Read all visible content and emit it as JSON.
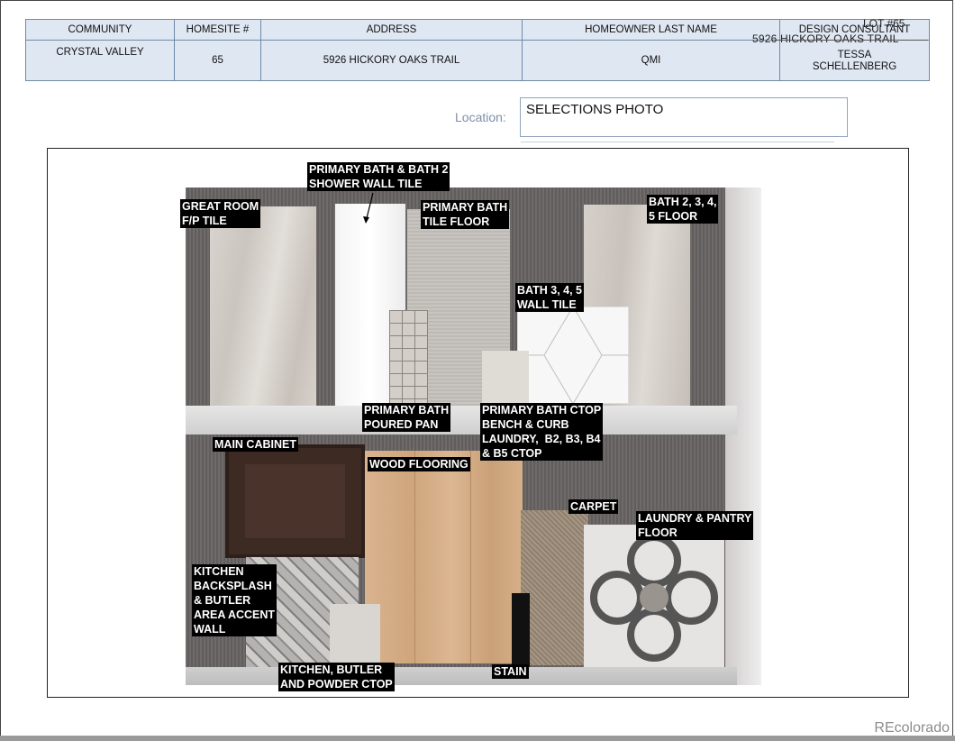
{
  "header": {
    "columns": [
      {
        "key": "community",
        "label": "COMMUNITY",
        "value": "CRYSTAL VALLEY"
      },
      {
        "key": "homesite",
        "label": "HOMESITE #",
        "value": "65"
      },
      {
        "key": "address",
        "label": "ADDRESS",
        "value": "5926 HICKORY OAKS TRAIL"
      },
      {
        "key": "homeowner",
        "label": "HOMEOWNER LAST NAME",
        "value": "QMI"
      },
      {
        "key": "consultant",
        "label": "DESIGN CONSULTANT",
        "value": "TESSA\nSCHELLENBERG"
      }
    ],
    "lot_overlay": "LOT #65",
    "address_overlay": "5926 HICKORY OAKS TRAIL"
  },
  "location": {
    "label": "Location:",
    "value": "SELECTIONS PHOTO"
  },
  "photo_labels": {
    "great_room": "GREAT ROOM\nF/P TILE",
    "shower_wall": "PRIMARY BATH & BATH 2\nSHOWER WALL TILE",
    "primary_floor": "PRIMARY BATH\nTILE FLOOR",
    "bath_floor": "BATH 2, 3, 4,\n5 FLOOR",
    "bath_wall": "BATH 3, 4, 5\nWALL TILE",
    "poured_pan": "PRIMARY BATH\nPOURED PAN",
    "ctop": "PRIMARY BATH CTOP\nBENCH & CURB\nLAUNDRY,  B2, B3, B4\n& B5 CTOP",
    "main_cabinet": "MAIN CABINET",
    "wood_flooring": "WOOD FLOORING",
    "carpet": "CARPET",
    "laundry_floor": "LAUNDRY & PANTRY\nFLOOR",
    "backsplash": "KITCHEN\nBACKSPLASH\n& BUTLER\nAREA ACCENT\nWALL",
    "kitchen_ctop": "KITCHEN, BUTLER\nAND POWDER CTOP",
    "stain": "STAIN"
  },
  "watermark": "REcolorado",
  "colors": {
    "header_bg": "#dfe7f2",
    "header_border": "#6e8aa8",
    "label_bg": "#000000"
  }
}
